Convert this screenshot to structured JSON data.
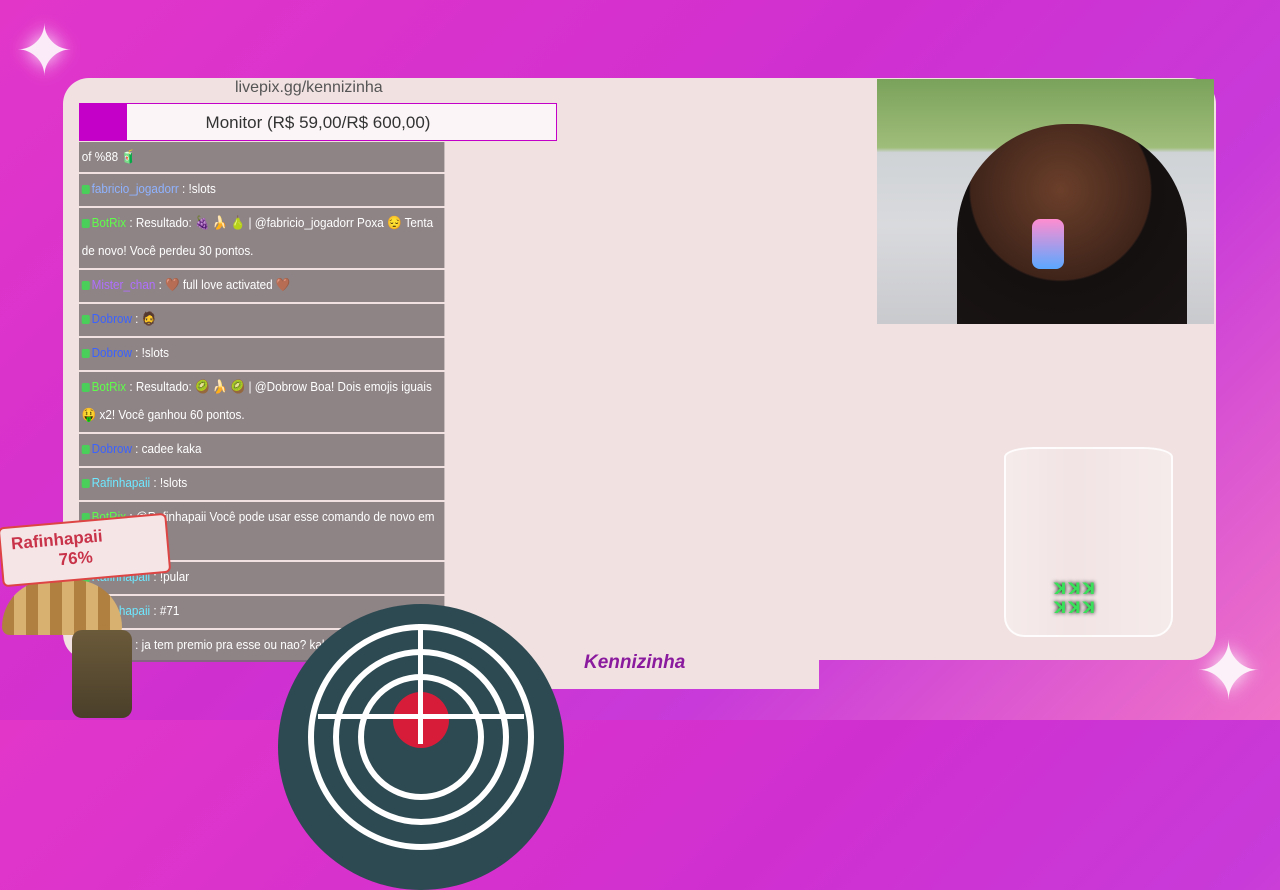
{
  "overlay": {
    "url": "livepix.gg/kennizinha",
    "goal_text": "Monitor (R$ 59,00/R$ 600,00)",
    "goal_progress_percent": 9.8,
    "streamer_name": "Kennizinha",
    "colors": {
      "accent": "#c400c8",
      "panel": "#f1e1e1",
      "name": "#8b1b9e"
    }
  },
  "chat": [
    {
      "user": "",
      "user_color": "#ffffff",
      "text": "of %88 🧃"
    },
    {
      "user": "fabricio_jogadorr",
      "user_color": "#8fb3ff",
      "text": ": !slots"
    },
    {
      "user": "BotRix",
      "user_color": "#5eff4a",
      "text": ": Resultado: 🍇 🍌 🍐 | @fabricio_jogadorr Poxa 😔 Tenta de novo! Você perdeu 30 pontos."
    },
    {
      "user": "Mister_chan",
      "user_color": "#b06fff",
      "text": ": 🤎 full love activated 🤎"
    },
    {
      "user": "Dobrow",
      "user_color": "#3a62ff",
      "text": ": 🧔"
    },
    {
      "user": "Dobrow",
      "user_color": "#3a62ff",
      "text": ": !slots"
    },
    {
      "user": "BotRix",
      "user_color": "#5eff4a",
      "text": ": Resultado: 🥝 🍌 🥝 | @Dobrow Boa! Dois emojis iguais 🤑 x2! Você ganhou 60 pontos."
    },
    {
      "user": "Dobrow",
      "user_color": "#3a62ff",
      "text": ": cadee kaka"
    },
    {
      "user": "Rafinhapaii",
      "user_color": "#6ee8ff",
      "text": ": !slots"
    },
    {
      "user": "BotRix",
      "user_color": "#5eff4a",
      "text": ": @Rafinhapaii Você pode usar esse comando de novo em 15s."
    },
    {
      "user": "Rafinhapaii",
      "user_color": "#6ee8ff",
      "text": ": !pular"
    },
    {
      "user": "Rafinhapaii",
      "user_color": "#6ee8ff",
      "text": ": #71"
    },
    {
      "user": "Dobrow",
      "user_color": "#3a62ff",
      "text": ": ja tem premio pra esse ou nao? kak"
    }
  ],
  "game": {
    "player_name": "Rafinhapaii",
    "player_percent": "76%"
  }
}
